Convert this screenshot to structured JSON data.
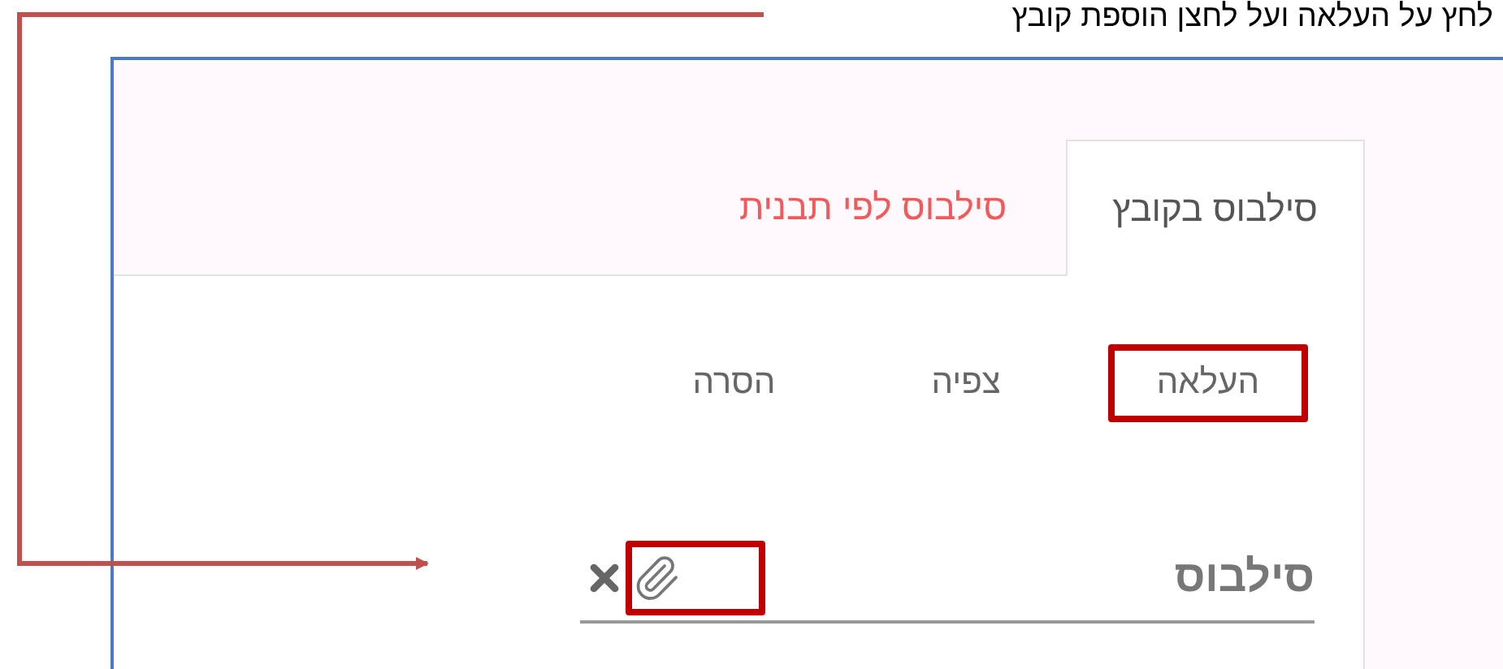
{
  "instruction": "לחץ על העלאה ועל לחצן הוספת קובץ",
  "tabs": [
    {
      "label": "סילבוס בקובץ",
      "selected": true
    },
    {
      "label": "סילבוס לפי תבנית",
      "selected": false
    }
  ],
  "actions": [
    {
      "label": "העלאה",
      "highlighted": true
    },
    {
      "label": "צפיה",
      "highlighted": false
    },
    {
      "label": "הסרה",
      "highlighted": false
    }
  ],
  "field": {
    "label": "סילבוס",
    "attach_highlighted": true
  }
}
